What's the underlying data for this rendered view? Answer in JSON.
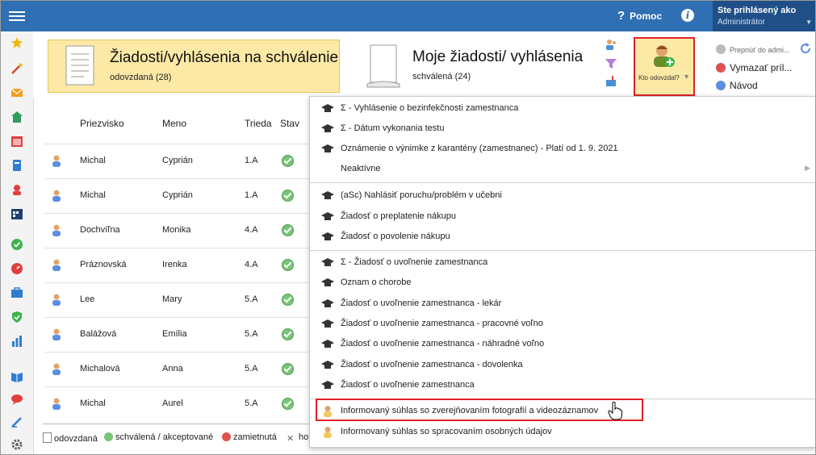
{
  "header": {
    "help_label": "Pomoc",
    "user_line1": "Ste prihlásený ako",
    "user_line2": "Administrátor"
  },
  "tiles": {
    "pending": {
      "title": "Žiadosti/vyhlásenia na schválenie",
      "subtitle": "odovzdaná (28)"
    },
    "mine": {
      "title": "Moje žiadosti/ vyhlásenia",
      "subtitle": "schválená (24)"
    }
  },
  "toolbar": {
    "kto_label": "Kto odovzdal?",
    "switch_label": "Prepnúť do admi...",
    "delete_label": "Vymazať príl...",
    "guide_label": "Návod"
  },
  "table": {
    "headers": [
      "Priezvisko",
      "Meno",
      "Trieda",
      "Stav"
    ],
    "rows": [
      {
        "surname": "Michal",
        "name": "Cyprián",
        "class": "1.A"
      },
      {
        "surname": "Michal",
        "name": "Cyprián",
        "class": "1.A"
      },
      {
        "surname": "Dochvíľna",
        "name": "Monika",
        "class": "4.A"
      },
      {
        "surname": "Práznovská",
        "name": "Irenka",
        "class": "4.A"
      },
      {
        "surname": "Lee",
        "name": "Mary",
        "class": "5.A"
      },
      {
        "surname": "Balážová",
        "name": "Emília",
        "class": "5.A"
      },
      {
        "surname": "Michalová",
        "name": "Anna",
        "class": "5.A"
      },
      {
        "surname": "Michal",
        "name": "Aurel",
        "class": "5.A"
      }
    ]
  },
  "legend": {
    "submitted": "odovzdaná",
    "approved": "schválená / akceptované",
    "rejected": "zamietnutá",
    "other": "ho"
  },
  "dropdown": {
    "items": [
      "Σ - Vyhlásenie o bezinfekčnosti zamestnanca",
      "Σ - Dátum vykonania testu",
      "Oznámenie o výnimke z karantény (zamestnanec) - Platí od 1. 9. 2021",
      "Neaktívne",
      "(aSc) Nahlásiť poruchu/problém v učebni",
      "Žiadosť o preplatenie nákupu",
      "Žiadosť o povolenie nákupu",
      "Σ - Žiadosť o uvoľnenie zamestnanca",
      "Oznam o chorobe",
      "Žiadosť o uvoľnenie zamestnanca - lekár",
      "Žiadosť o uvoľnenie zamestnanca - pracovné voľno",
      "Žiadosť o uvoľnenie zamestnanca - náhradné voľno",
      "Žiadosť o uvoľnenie zamestnanca - dovolenka",
      "Žiadosť o uvoľnenie zamestnanca",
      "Informovaný súhlas so zverejňovaním fotografií a videozáznamov",
      "Informovaný súhlas so spracovaním osobných údajov"
    ]
  },
  "colors": {
    "topbar": "#2f6fb3",
    "highlight": "#e0202a",
    "tile_active": "#fde9a6"
  }
}
